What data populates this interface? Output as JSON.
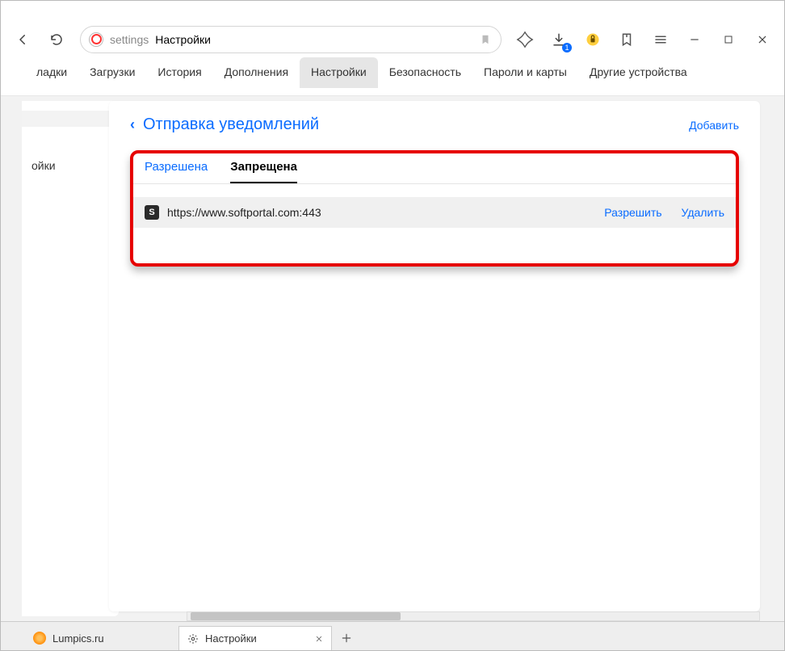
{
  "toolbar": {
    "address_protocol": "settings",
    "address_title": "Настройки",
    "download_badge": "1"
  },
  "nav_tabs": {
    "items": [
      "ладки",
      "Загрузки",
      "История",
      "Дополнения",
      "Настройки",
      "Безопасность",
      "Пароли и карты",
      "Другие устройства"
    ],
    "active_index": 4
  },
  "sidebar": {
    "items": [
      "",
      "ойки"
    ]
  },
  "card": {
    "title": "Отправка уведомлений",
    "add_label": "Добавить",
    "perm_tabs": {
      "allowed": "Разрешена",
      "denied": "Запрещена"
    },
    "site_row": {
      "favicon_letter": "S",
      "url": "https://www.softportal.com:443",
      "allow_action": "Разрешить",
      "delete_action": "Удалить"
    }
  },
  "browser_tabs": {
    "items": [
      {
        "title": "Lumpics.ru",
        "active": false
      },
      {
        "title": "Настройки",
        "active": true
      }
    ],
    "new_tab": "+"
  }
}
